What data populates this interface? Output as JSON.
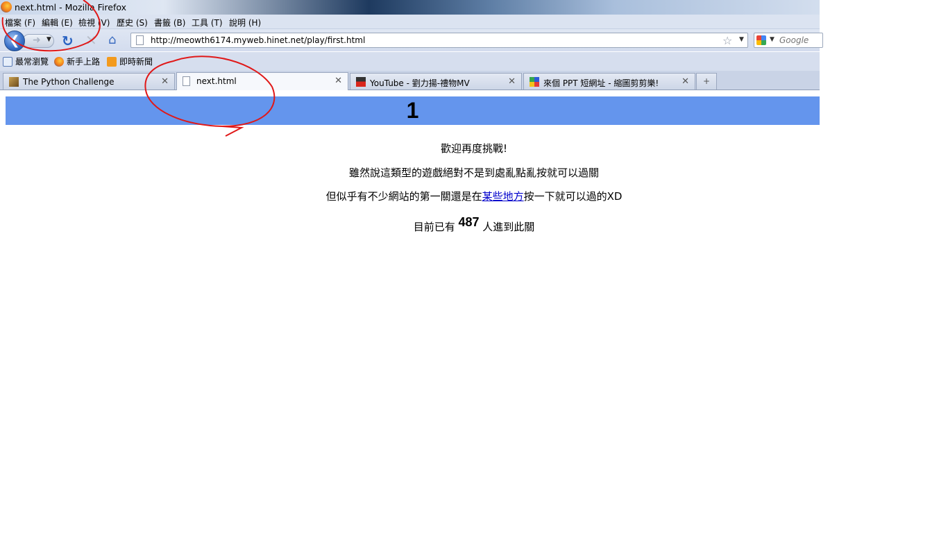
{
  "window": {
    "title": "next.html - Mozilla Firefox"
  },
  "menu": [
    {
      "label": "檔案 (F)"
    },
    {
      "label": "編輯 (E)"
    },
    {
      "label": "檢視 (V)"
    },
    {
      "label": "歷史 (S)"
    },
    {
      "label": "書籤 (B)"
    },
    {
      "label": "工具 (T)"
    },
    {
      "label": "說明 (H)"
    }
  ],
  "navigation": {
    "url": "http://meowth6174.myweb.hinet.net/play/first.html",
    "search_placeholder": "Google"
  },
  "bookmarks": [
    {
      "label": "最常瀏覽",
      "icon": "magnifier-page-icon"
    },
    {
      "label": "新手上路",
      "icon": "firefox-icon"
    },
    {
      "label": "即時新聞",
      "icon": "rss-feed-icon"
    }
  ],
  "tabs": [
    {
      "label": "The Python Challenge",
      "icon": "python-challenge-icon",
      "active": false
    },
    {
      "label": "next.html",
      "icon": "page-icon",
      "active": true
    },
    {
      "label": "YouTube - 劉力揚-禮物MV",
      "icon": "youtube-icon",
      "active": false
    },
    {
      "label": "來個 PPT 短網址 - 縮圖剪剪樂!",
      "icon": "ppt-icon",
      "active": false
    }
  ],
  "page": {
    "heading": "1",
    "line1": "歡迎再度挑戰!",
    "line2": "雖然說這類型的遊戲絕對不是到處亂點亂按就可以過關",
    "line3_before": "但似乎有不少網站的第一關還是在",
    "line3_link": "某些地方",
    "line3_after": "按一下就可以過的XD",
    "line4_before": "目前已有 ",
    "visitor_count": "487",
    "line4_after": " 人進到此關"
  },
  "colors": {
    "banner": "#6495ed",
    "annotation": "#e01818"
  }
}
